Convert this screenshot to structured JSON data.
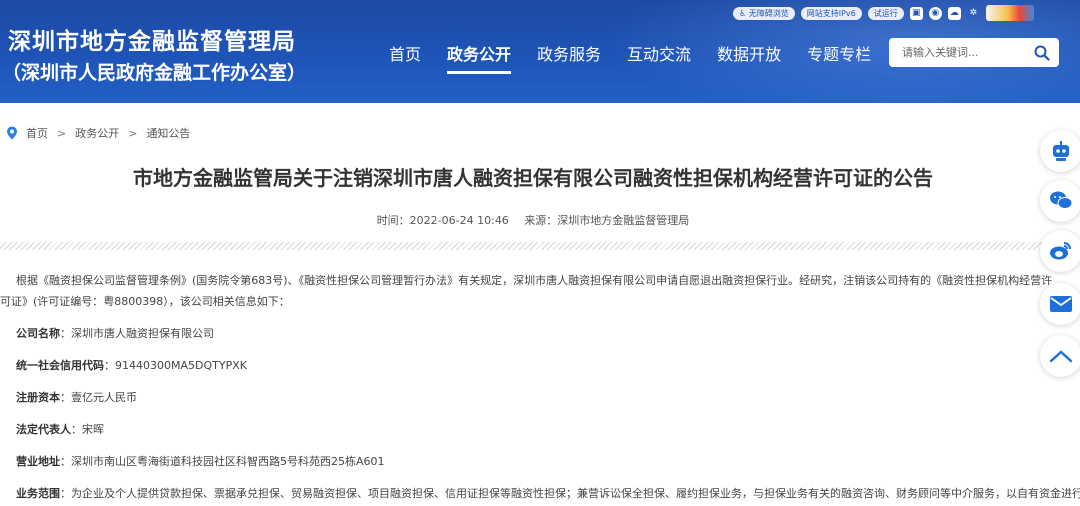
{
  "header": {
    "title": "深圳市地方金融监督管理局",
    "subtitle": "（深圳市人民政府金融工作办公室）",
    "tools": [
      "无障碍浏览",
      "网站支持IPv6",
      "试运行"
    ],
    "icons": [
      "accessibility-icon",
      "weibo-icon",
      "wechat-icon",
      "app-icon",
      "city-logo"
    ]
  },
  "nav": {
    "items": [
      "首页",
      "政务公开",
      "政务服务",
      "互动交流",
      "数据开放",
      "专题专栏"
    ],
    "active": "政务公开"
  },
  "search": {
    "placeholder": "请输入关键词..."
  },
  "breadcrumb": [
    "首页",
    "政务公开",
    "通知公告"
  ],
  "article": {
    "title": "市地方金融监管局关于注销深圳市唐人融资担保有限公司融资性担保机构经营许可证的公告",
    "time_label": "时间：2022-06-24 10:46",
    "source_label": "来源：深圳市地方金融监督管理局",
    "intro": "根据《融资担保公司监督管理条例》(国务院令第683号)、《融资性担保公司管理暂行办法》有关规定，深圳市唐人融资担保有限公司申请自愿退出融资担保行业。经研究，注销该公司持有的《融资性担保机构经营许可证》(许可证编号：粤8800398），该公司相关信息如下：",
    "fields": [
      {
        "label": "公司名称",
        "value": "深圳市唐人融资担保有限公司"
      },
      {
        "label": "统一社会信用代码",
        "value": "91440300MA5DQTYPXK"
      },
      {
        "label": "注册资本",
        "value": "壹亿元人民币"
      },
      {
        "label": "法定代表人",
        "value": "宋晖"
      },
      {
        "label": "营业地址",
        "value": "深圳市南山区粤海街道科技园社区科智西路5号科苑西25栋A601"
      },
      {
        "label": "业务范围",
        "value": "为企业及个人提供贷款担保、票据承兑担保、贸易融资担保、项目融资担保、信用证担保等融资性担保；兼营诉讼保全担保、履约担保业务，与担保业务有关的融资咨询、财务顾问等中介服务，以自有资金进行投"
      }
    ]
  },
  "sidebar": [
    "robot-icon",
    "wechat-icon",
    "weibo-icon",
    "mail-icon",
    "back-to-top-icon"
  ],
  "colors": {
    "header_blue": "#1e54b8",
    "text": "#333333"
  }
}
